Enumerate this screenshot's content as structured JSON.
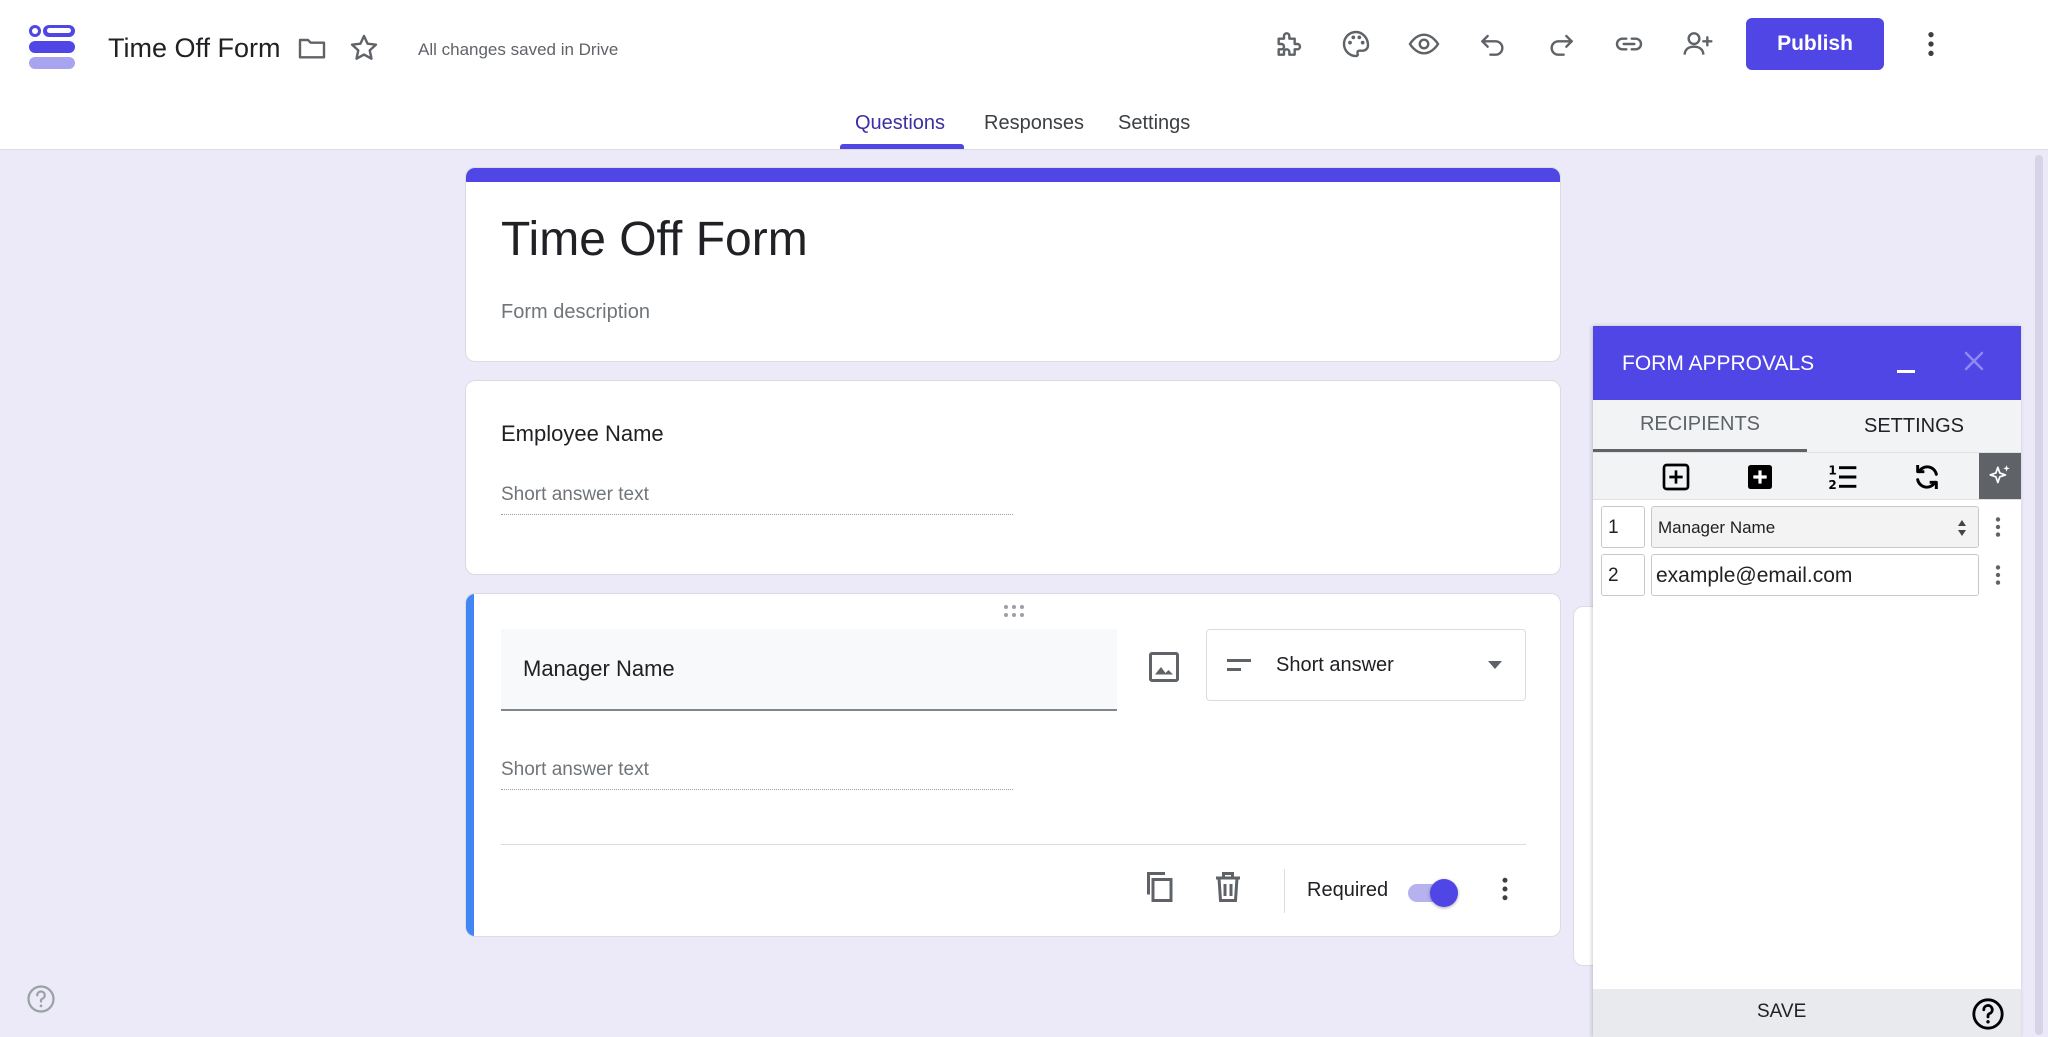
{
  "header": {
    "doc_title": "Time Off Form",
    "save_status": "All changes saved in Drive",
    "publish_label": "Publish",
    "icons": [
      "logo-icon",
      "folder-icon",
      "star-icon",
      "addons-icon",
      "palette-icon",
      "preview-icon",
      "undo-icon",
      "redo-icon",
      "link-icon",
      "add-collaborator-icon",
      "more-vert-icon"
    ]
  },
  "tabs": [
    {
      "label": "Questions",
      "active": true
    },
    {
      "label": "Responses",
      "active": false
    },
    {
      "label": "Settings",
      "active": false
    }
  ],
  "form": {
    "title": "Time Off Form",
    "description_placeholder": "Form description",
    "questions": [
      {
        "title": "Employee Name",
        "answer_placeholder": "Short answer text"
      },
      {
        "title": "Manager Name",
        "answer_placeholder": "Short answer text",
        "type": "Short answer",
        "required_label": "Required",
        "required": true
      }
    ]
  },
  "approvals_panel": {
    "title": "FORM APPROVALS",
    "tabs": [
      "RECIPIENTS",
      "SETTINGS"
    ],
    "recipients": [
      {
        "number": "1",
        "value": "Manager Name",
        "kind": "select"
      },
      {
        "number": "2",
        "value": "example@email.com",
        "kind": "input"
      }
    ],
    "save_label": "SAVE"
  },
  "colors": {
    "accent": "#4f46e5",
    "background": "#eceaf8",
    "question_focus": "#4285f4"
  }
}
